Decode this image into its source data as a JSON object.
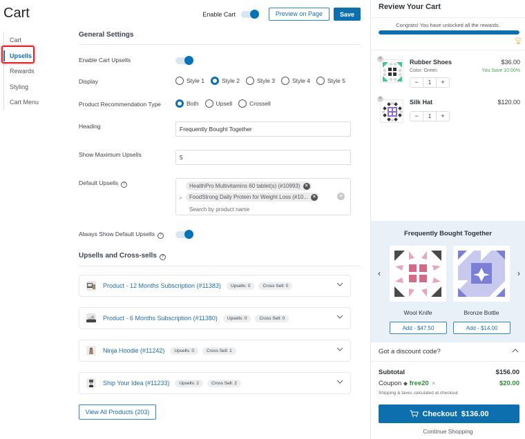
{
  "page": {
    "title": "Cart"
  },
  "topbar": {
    "enable_cart_label": "Enable Cart",
    "enable_cart_on": true,
    "preview_label": "Preview on Page",
    "save_label": "Save"
  },
  "sidebar": {
    "items": [
      {
        "label": "Cart",
        "active": false
      },
      {
        "label": "Upsells",
        "active": true
      },
      {
        "label": "Rewards",
        "active": false
      },
      {
        "label": "Styling",
        "active": false
      },
      {
        "label": "Cart Menu",
        "active": false
      }
    ]
  },
  "general": {
    "section_title": "General Settings",
    "enable_upsells_label": "Enable Cart Upsells",
    "enable_upsells_on": true,
    "display_label": "Display",
    "display_options": [
      "Style 1",
      "Style 2",
      "Style 3",
      "Style 4",
      "Style 5"
    ],
    "display_selected": "Style 2",
    "rec_type_label": "Product Recommendation Type",
    "rec_type_options": [
      "Both",
      "Upsell",
      "Crossell"
    ],
    "rec_type_selected": "Both",
    "heading_label": "Heading",
    "heading_value": "Frequently Bought Together",
    "max_upsells_label": "Show Maximum Upsells",
    "max_upsells_value": "5",
    "default_upsells_label": "Default Upsells",
    "default_upsells_chips": [
      "HealthPro Multivitamins 60 tablet(s) (#10993)",
      "FoodStrong Daily Protein for Weight Loss (#10..."
    ],
    "default_upsells_placeholder": "Search by product name",
    "always_show_label": "Always Show Default Upsells",
    "always_show_on": true
  },
  "upsells_cross": {
    "section_title": "Upsells and Cross-sells",
    "products": [
      {
        "name": "Product - 12 Months Subscription (#11383)",
        "upsells": "Upsells: 0",
        "cross": "Cross Sell: 0"
      },
      {
        "name": "Product - 6 Months Subscription (#11380)",
        "upsells": "Upsells: 0",
        "cross": "Cross Sell: 0"
      },
      {
        "name": "Ninja Hoodie (#11242)",
        "upsells": "Upsells: 0",
        "cross": "Cross Sell: 1"
      },
      {
        "name": "Ship Your Idea (#11233)",
        "upsells": "Upsells: 2",
        "cross": "Cross Sell: 2"
      }
    ],
    "view_all_label": "View All Products (203)"
  },
  "review_cart": {
    "title": "Review Your Cart",
    "rewards_message": "Congrats! You have unlocked all the rewards.",
    "rewards_progress_percent": 100,
    "items": [
      {
        "name": "Rubber Shoes",
        "variant": "Color: Green",
        "price": "$36.00",
        "savings": "You Save 10.00%",
        "qty": "1"
      },
      {
        "name": "Silk Hat",
        "variant": "",
        "price": "$120.00",
        "savings": "",
        "qty": "1"
      }
    ],
    "fbt": {
      "title": "Frequently Bought Together",
      "products": [
        {
          "name": "Wool Knife",
          "add_label": "Add -  $47.50"
        },
        {
          "name": "Bronze Bottle",
          "add_label": "Add -  $14.00"
        }
      ]
    },
    "discount_label": "Got a discount code?",
    "subtotal_label": "Subtotal",
    "subtotal_value": "$156.00",
    "coupon_label": "Coupon",
    "coupon_code": "free20",
    "coupon_value": "$20.00",
    "shipping_note": "Shipping & taxes calculated at checkout",
    "checkout_label": "Checkout  $136.00",
    "continue_label": "Continue Shopping"
  }
}
